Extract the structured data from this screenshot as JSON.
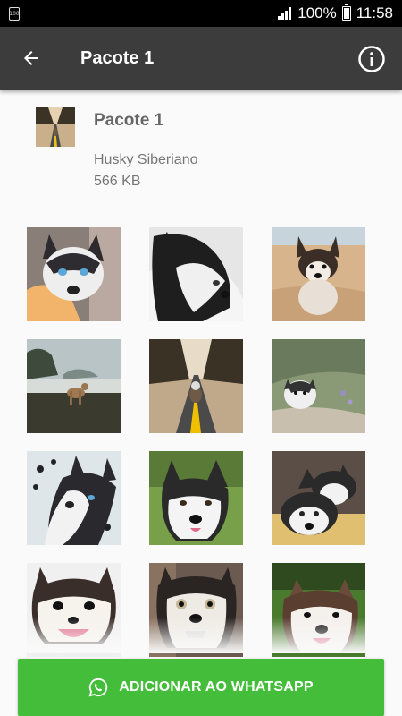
{
  "status_bar": {
    "notification_badge": "100",
    "battery_percent": "100%",
    "time": "11:58"
  },
  "toolbar": {
    "title": "Pacote 1",
    "back_icon": "arrow-left-icon",
    "info_icon": "info-icon"
  },
  "pack": {
    "name": "Pacote 1",
    "author": "Husky Siberiano",
    "size": "566 KB"
  },
  "stickers": [
    {
      "name": "husky-blue-eyes-hand"
    },
    {
      "name": "husky-black-white"
    },
    {
      "name": "husky-puppy-sand"
    },
    {
      "name": "husky-beach-walk"
    },
    {
      "name": "husky-road"
    },
    {
      "name": "husky-puppy-grass"
    },
    {
      "name": "husky-snow"
    },
    {
      "name": "husky-field"
    },
    {
      "name": "husky-two-dogs"
    },
    {
      "name": "husky-puppy-tongue"
    },
    {
      "name": "husky-funny-face"
    },
    {
      "name": "husky-smiling-grass"
    }
  ],
  "add_button": {
    "label": "ADICIONAR AO WHATSAPP",
    "icon": "whatsapp-icon"
  },
  "colors": {
    "toolbar": "#3c3c3c",
    "accent_green": "#43bd3a"
  }
}
